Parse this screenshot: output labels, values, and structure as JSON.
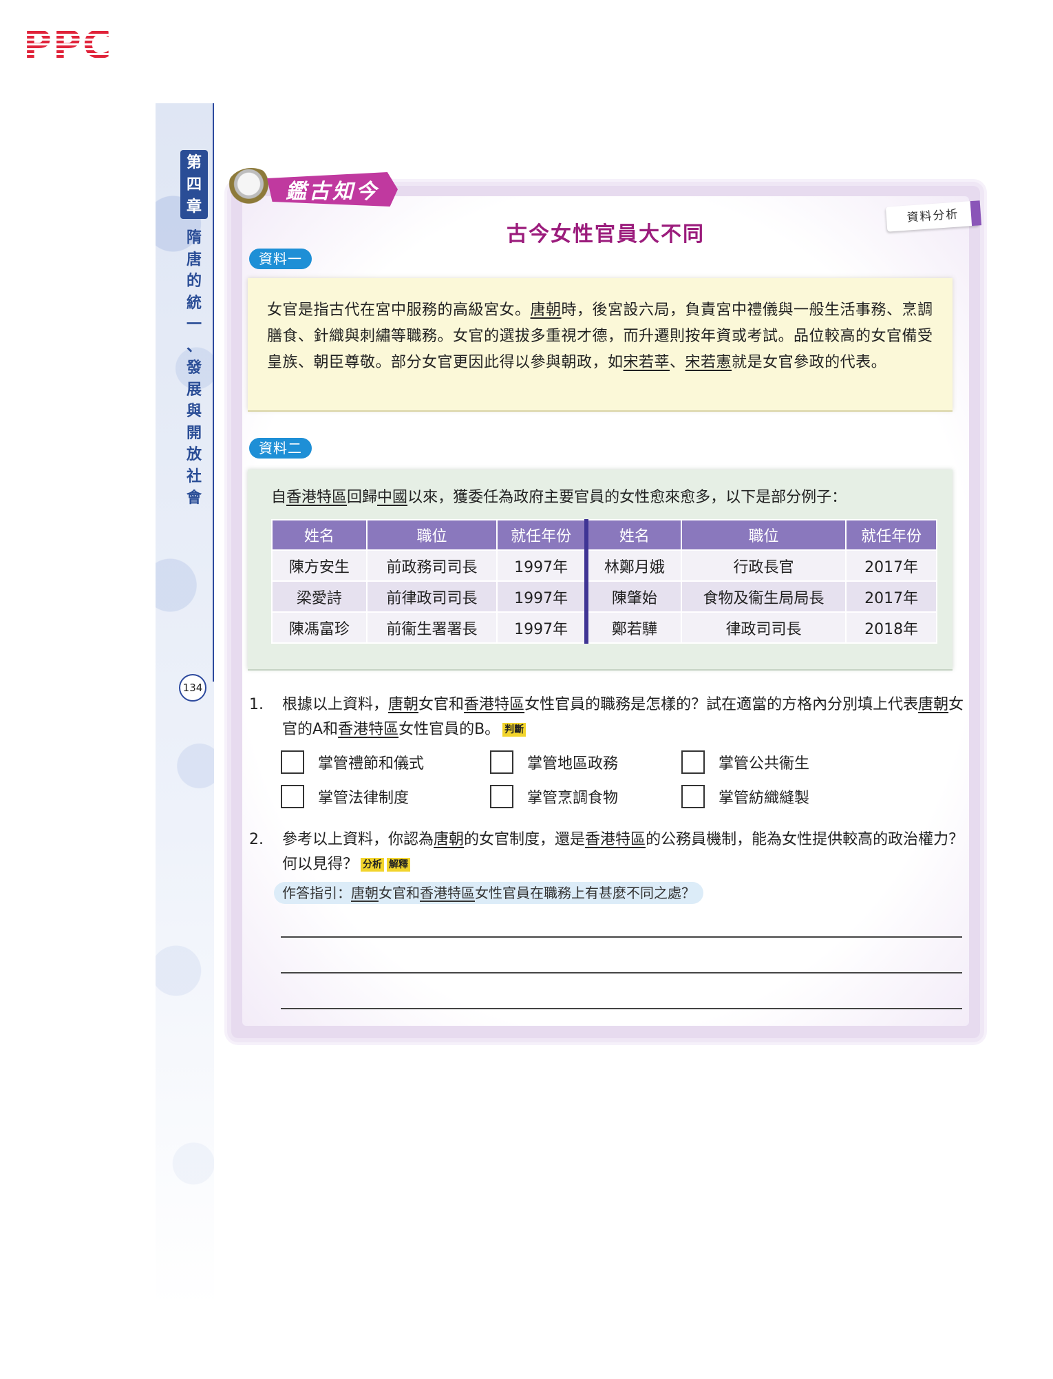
{
  "publisher_logo": "PPC",
  "chapter": {
    "tab_chars": [
      "第",
      "四",
      "章"
    ],
    "title_chars": [
      "隋",
      "唐",
      "的",
      "統",
      "一",
      "、",
      "發",
      "展",
      "與",
      "開",
      "放",
      "社",
      "會"
    ]
  },
  "page_number": "134",
  "section_banner": "鑑古知今",
  "title": "古今女性官員大不同",
  "skill_tag": "資料分析",
  "source1": {
    "label": "資料一",
    "text_parts": [
      "女官是指古代在宮中服務的高級宮女。",
      "唐朝",
      "時，後宮設六局，負責宮中禮儀與一般生活事務、烹調膳食、針織與刺繡等職務。女官的選拔多重視才德，而升遷則按年資或考試。品位較高的女官備受皇族、朝臣尊敬。部分女官更因此得以參與朝政，如",
      "宋若莘",
      "、",
      "宋若憲",
      "就是女官參政的代表。"
    ]
  },
  "source2": {
    "label": "資料二",
    "intro_parts": [
      "自",
      "香港特區",
      "回歸",
      "中國",
      "以來，獲委任為政府主要官員的女性愈來愈多，以下是部分例子："
    ],
    "headers": [
      "姓名",
      "職位",
      "就任年份",
      "姓名",
      "職位",
      "就任年份"
    ],
    "rows": [
      [
        "陳方安生",
        "前政務司司長",
        "1997年",
        "林鄭月娥",
        "行政長官",
        "2017年"
      ],
      [
        "梁愛詩",
        "前律政司司長",
        "1997年",
        "陳肇始",
        "食物及衞生局局長",
        "2017年"
      ],
      [
        "陳馮富珍",
        "前衞生署署長",
        "1997年",
        "鄭若驊",
        "律政司司長",
        "2018年"
      ]
    ]
  },
  "q1": {
    "number": "1.",
    "parts": [
      "根據以上資料，",
      "唐朝",
      "女官和",
      "香港特區",
      "女性官員的職務是怎樣的？試在適當的方格內分別填上代表",
      "唐朝",
      "女官的A和",
      "香港特區",
      "女性官員的B。"
    ],
    "tag": "判斷",
    "options": [
      "掌管禮節和儀式",
      "掌管地區政務",
      "掌管公共衞生",
      "掌管法律制度",
      "掌管烹調食物",
      "掌管紡織縫製"
    ]
  },
  "q2": {
    "number": "2.",
    "parts": [
      "參考以上資料，你認為",
      "唐朝",
      "的女官制度，還是",
      "香港特區",
      "的公務員機制，能為女性提供較高的政治權力？何以見得？"
    ],
    "tags": [
      "分析",
      "解釋"
    ],
    "hint_parts": [
      "作答指引：",
      "唐朝",
      "女官和",
      "香港特區",
      "女性官員在職務上有甚麼不同之處？"
    ]
  },
  "colors": {
    "accent_purple": "#9b1c7c",
    "source_label_blue": "#1e8fd6",
    "table_header": "#8a78bd",
    "chapter_blue": "#2a4d96",
    "logo_red": "#e0233a"
  }
}
